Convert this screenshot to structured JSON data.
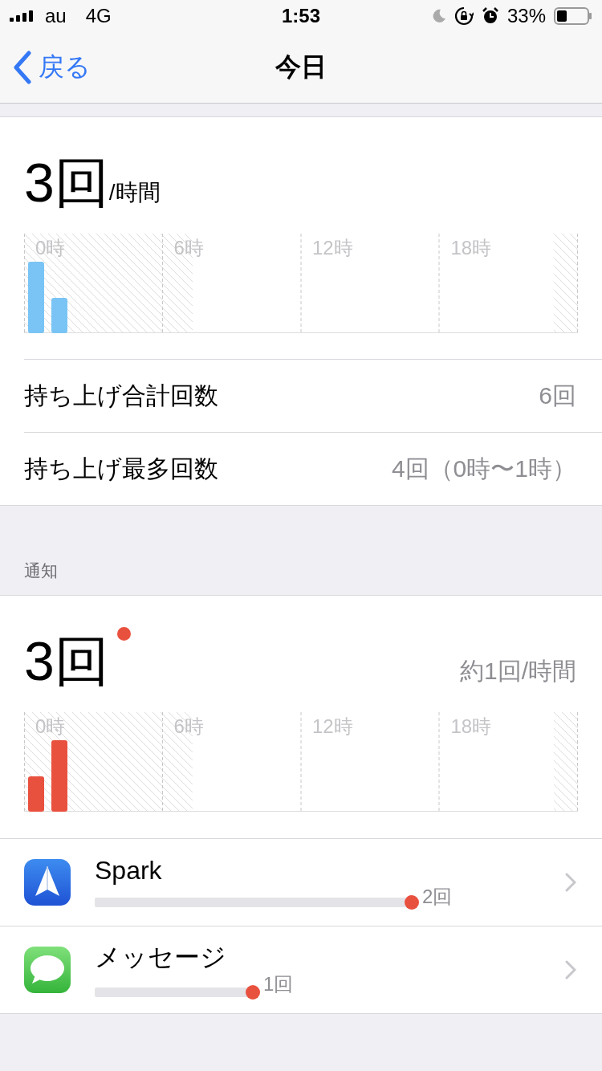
{
  "status_bar": {
    "carrier": "au",
    "network": "4G",
    "time": "1:53",
    "battery": "33%"
  },
  "nav": {
    "back": "戻る",
    "title": "今日"
  },
  "pickups": {
    "value": "3回",
    "unit": "/時間",
    "hour_labels": [
      "0時",
      "6時",
      "12時",
      "18時"
    ],
    "rows": [
      {
        "label": "持ち上げ合計回数",
        "value": "6回"
      },
      {
        "label": "持ち上げ最多回数",
        "value": "4回（0時〜1時）"
      }
    ]
  },
  "notifications": {
    "header": "通知",
    "value": "3回",
    "rate": "約1回/時間",
    "hour_labels": [
      "0時",
      "6時",
      "12時",
      "18時"
    ],
    "apps": [
      {
        "kind": "spark",
        "name": "Spark",
        "count": "2回"
      },
      {
        "kind": "messages",
        "name": "メッセージ",
        "count": "1回"
      }
    ]
  }
}
